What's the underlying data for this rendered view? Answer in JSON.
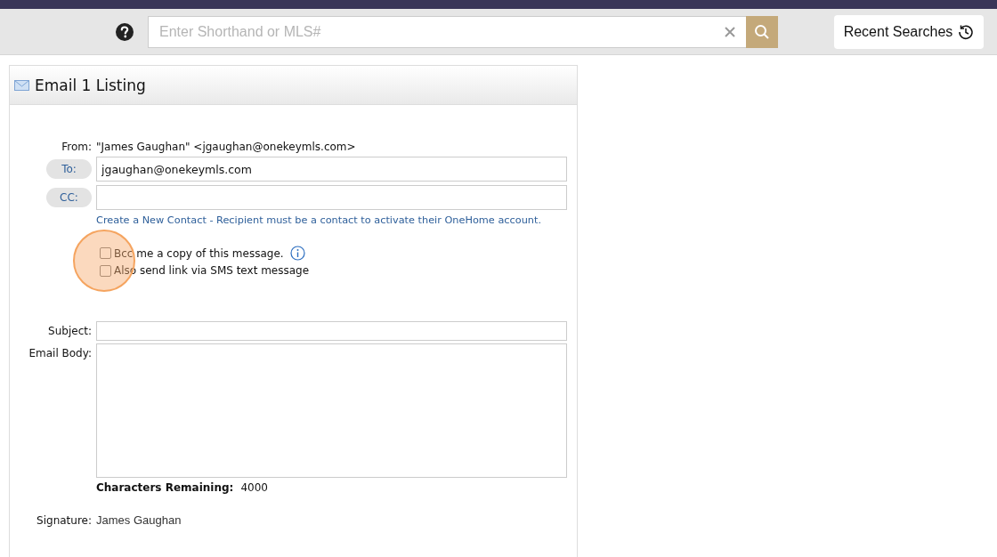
{
  "search": {
    "placeholder": "Enter Shorthand or MLS#"
  },
  "recent_searches": {
    "label": "Recent Searches"
  },
  "panel": {
    "title": "Email 1 Listing"
  },
  "from": {
    "label": "From:",
    "value": "\"James Gaughan\" <jgaughan@onekeymls.com>"
  },
  "to": {
    "label": "To:",
    "value": "jgaughan@onekeymls.com"
  },
  "cc": {
    "label": "CC:"
  },
  "contact_link": "Create a New Contact - Recipient must be a contact to activate their OneHome account.",
  "options": [
    {
      "label": "Bcc me a copy of this message.",
      "checked": false,
      "info": true
    },
    {
      "label": "Also send link via SMS text message",
      "checked": false,
      "info": false
    }
  ],
  "subject": {
    "label": "Subject:"
  },
  "body": {
    "label": "Email Body:"
  },
  "characters_remaining": {
    "label": "Characters Remaining:",
    "value": "4000"
  },
  "signature": {
    "label": "Signature:",
    "value": "James Gaughan"
  }
}
